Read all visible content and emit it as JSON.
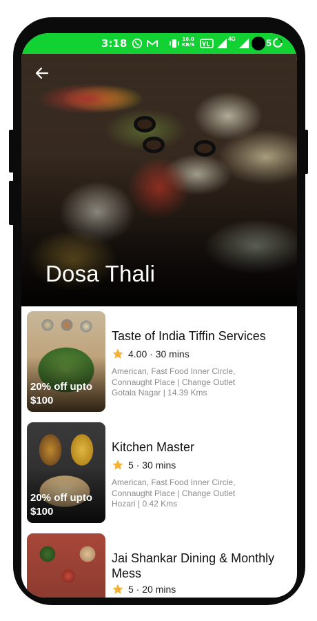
{
  "status_bar": {
    "time": "3:18",
    "speed_value": "16.0",
    "speed_unit": "KB/S",
    "network": "4G",
    "battery_digit": "5",
    "bg_color": "#12d132"
  },
  "header": {
    "back_icon": "arrow-left-icon",
    "title": "Dosa Thali"
  },
  "restaurants": [
    {
      "name": "Taste of India Tiffin Services",
      "rating": "4.00 · 30 mins",
      "description": "American, Fast Food Inner Circle, Connaught Place | Change Outlet",
      "location": "Gotala Nagar | 14.39 Kms",
      "offer_line1": "20% off upto",
      "offer_line2": "$100"
    },
    {
      "name": "Kitchen Master",
      "rating": "5 · 30 mins",
      "description": "American, Fast Food Inner Circle, Connaught Place | Change Outlet",
      "location": "Hozari | 0.42 Kms",
      "offer_line1": "20% off upto",
      "offer_line2": "$100"
    },
    {
      "name": "Jai Shankar Dining & Monthly Mess",
      "rating": "5 · 20 mins"
    }
  ],
  "colors": {
    "accent_green": "#12d132",
    "star": "#f6b234"
  }
}
